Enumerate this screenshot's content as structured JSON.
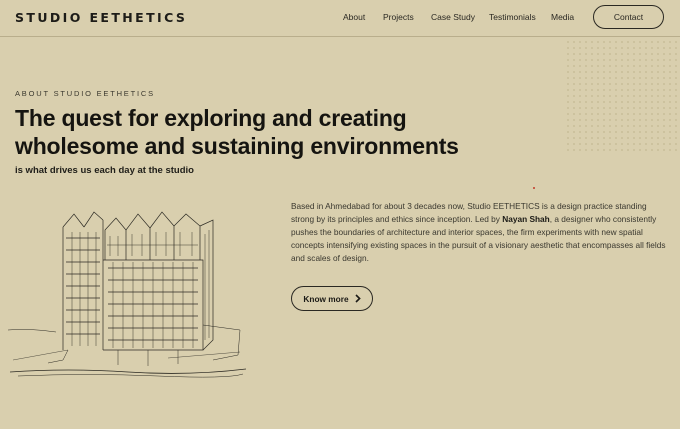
{
  "header": {
    "brand": "STUDIO EETHETICS",
    "nav": [
      "About",
      "Projects",
      "Case Study",
      "Testimonials",
      "Media"
    ],
    "contact_label": "Contact"
  },
  "hero": {
    "eyebrow": "ABOUT STUDIO EETHETICS",
    "headline": "The quest for exploring and creating wholesome and sustaining environments",
    "subline": "is what drives us each day at the studio"
  },
  "about": {
    "text_before": "Based in Ahmedabad for about 3 decades now, Studio EETHETICS is a design practice standing strong by its principles and ethics since inception. Led by ",
    "highlight": "Nayan Shah",
    "text_after": ", a designer who consistently pushes the boundaries of architecture and interior spaces, the firm experiments with new spatial concepts intensifying existing spaces in the pursuit of a visionary aesthetic that encompasses all fields and scales of design.",
    "button_label": "Know more",
    "button_icon": "chevron-right-icon"
  },
  "colors": {
    "background": "#d9cfae",
    "text": "#1b1a16",
    "accent_dot": "#c23a2a"
  }
}
